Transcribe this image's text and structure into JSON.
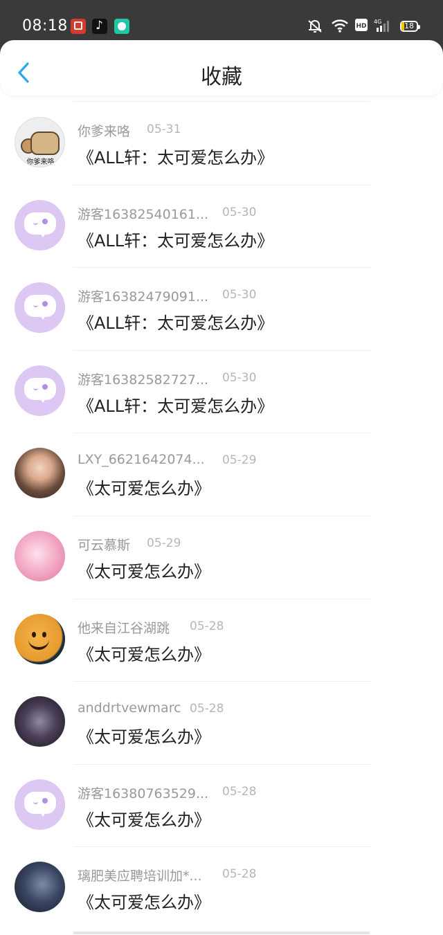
{
  "status_bar": {
    "time": "08:18",
    "battery": "18",
    "network": "4G",
    "hd": "HD"
  },
  "header": {
    "title": "收藏"
  },
  "items": [
    {
      "username": "你爹来咯",
      "date": "05-31",
      "message": "《ALL轩：太可爱怎么办》",
      "avatar": "cat-avatar",
      "avatar_caption": "你爹来咯"
    },
    {
      "username": "游客16382540161...",
      "date": "05-30",
      "message": "《ALL轩：太可爱怎么办》",
      "avatar": "chat-bubble-avatar"
    },
    {
      "username": "游客16382479091...",
      "date": "05-30",
      "message": "《ALL轩：太可爱怎么办》",
      "avatar": "chat-bubble-avatar"
    },
    {
      "username": "游客16382582727...",
      "date": "05-30",
      "message": "《ALL轩：太可爱怎么办》",
      "avatar": "chat-bubble-avatar"
    },
    {
      "username": "LXY_6621642074...",
      "date": "05-29",
      "message": "《太可爱怎么办》",
      "avatar": "photo-avatar"
    },
    {
      "username": "可云慕斯",
      "date": "05-29",
      "message": "《太可爱怎么办》",
      "avatar": "anime-avatar"
    },
    {
      "username": "他来自江谷湖跳",
      "date": "05-28",
      "message": "《太可爱怎么办》",
      "avatar": "smiley-avatar"
    },
    {
      "username": "anddrtvewmarc",
      "date": "05-28",
      "message": "《太可爱怎么办》",
      "avatar": "photo-avatar"
    },
    {
      "username": "游客16380763529...",
      "date": "05-28",
      "message": "《太可爱怎么办》",
      "avatar": "chat-bubble-avatar"
    },
    {
      "username": "璃肥美应聘培训加*...",
      "date": "05-28",
      "message": "《太可爱怎么办》",
      "avatar": "photo-avatar"
    }
  ]
}
